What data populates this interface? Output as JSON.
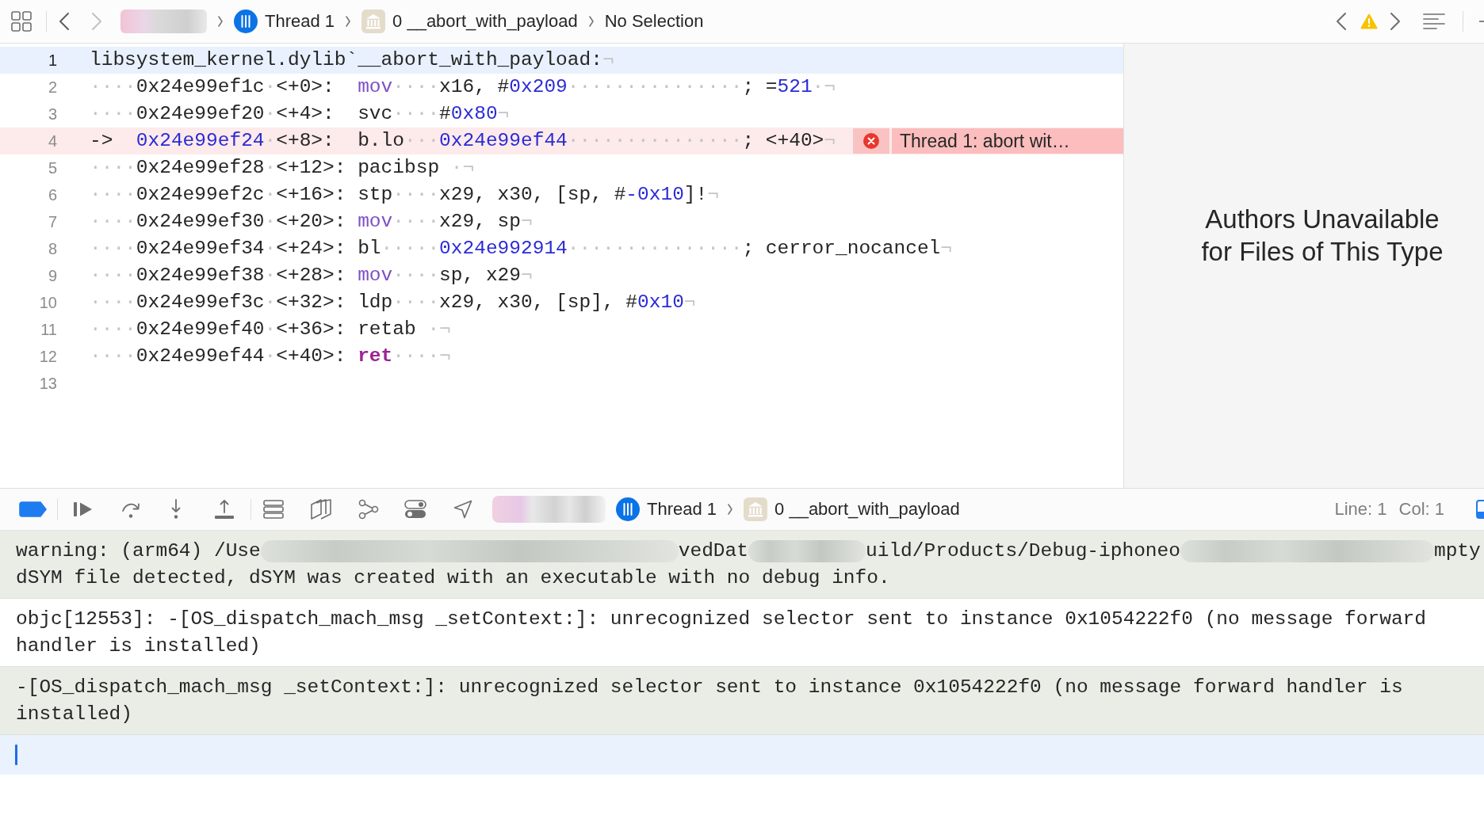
{
  "jump_bar": {
    "back_enabled": true,
    "forward_enabled": false,
    "crumbs": [
      {
        "kind": "redacted"
      },
      {
        "kind": "thread",
        "label": "Thread 1"
      },
      {
        "kind": "frame",
        "label": "0 __abort_with_payload"
      },
      {
        "kind": "plain",
        "label": "No Selection"
      }
    ]
  },
  "editor": {
    "lines": [
      {
        "number": "1",
        "current": true,
        "error": false,
        "tokens": [
          {
            "kind": "plain",
            "text": "libsystem_kernel.dylib`__abort_with_payload:"
          },
          {
            "kind": "ws",
            "text": "¬"
          }
        ]
      },
      {
        "number": "2",
        "current": false,
        "error": false,
        "tokens": [
          {
            "kind": "ws",
            "text": "····"
          },
          {
            "kind": "plain",
            "text": "0x24e99ef1c"
          },
          {
            "kind": "ws",
            "text": "·"
          },
          {
            "kind": "plain",
            "text": "<+0>:  "
          },
          {
            "kind": "mnemonic",
            "text": "mov"
          },
          {
            "kind": "ws",
            "text": "····"
          },
          {
            "kind": "plain",
            "text": "x16, #"
          },
          {
            "kind": "number",
            "text": "0x209"
          },
          {
            "kind": "ws",
            "text": "···············"
          },
          {
            "kind": "plain",
            "text": "; ="
          },
          {
            "kind": "number",
            "text": "521"
          },
          {
            "kind": "ws",
            "text": "·¬"
          }
        ]
      },
      {
        "number": "3",
        "current": false,
        "error": false,
        "tokens": [
          {
            "kind": "ws",
            "text": "····"
          },
          {
            "kind": "plain",
            "text": "0x24e99ef20"
          },
          {
            "kind": "ws",
            "text": "·"
          },
          {
            "kind": "plain",
            "text": "<+4>:  svc"
          },
          {
            "kind": "ws",
            "text": "····"
          },
          {
            "kind": "plain",
            "text": "#"
          },
          {
            "kind": "number",
            "text": "0x80"
          },
          {
            "kind": "ws",
            "text": "¬"
          }
        ]
      },
      {
        "number": "4",
        "current": false,
        "error": true,
        "tokens": [
          {
            "kind": "plain",
            "text": "->  "
          },
          {
            "kind": "number",
            "text": "0x24e99ef24"
          },
          {
            "kind": "ws",
            "text": "·"
          },
          {
            "kind": "plain",
            "text": "<+8>:  b.lo"
          },
          {
            "kind": "ws",
            "text": "···"
          },
          {
            "kind": "number",
            "text": "0x24e99ef44"
          },
          {
            "kind": "ws",
            "text": "···············"
          },
          {
            "kind": "plain",
            "text": "; <+40>"
          },
          {
            "kind": "ws",
            "text": "¬"
          }
        ],
        "annotation": {
          "text": "Thread 1: abort wit…"
        }
      },
      {
        "number": "5",
        "current": false,
        "error": false,
        "tokens": [
          {
            "kind": "ws",
            "text": "····"
          },
          {
            "kind": "plain",
            "text": "0x24e99ef28"
          },
          {
            "kind": "ws",
            "text": "·"
          },
          {
            "kind": "plain",
            "text": "<+12>: pacibsp "
          },
          {
            "kind": "ws",
            "text": "·¬"
          }
        ]
      },
      {
        "number": "6",
        "current": false,
        "error": false,
        "tokens": [
          {
            "kind": "ws",
            "text": "····"
          },
          {
            "kind": "plain",
            "text": "0x24e99ef2c"
          },
          {
            "kind": "ws",
            "text": "·"
          },
          {
            "kind": "plain",
            "text": "<+16>: stp"
          },
          {
            "kind": "ws",
            "text": "····"
          },
          {
            "kind": "plain",
            "text": "x29, x30, [sp, #"
          },
          {
            "kind": "number",
            "text": "-0x10"
          },
          {
            "kind": "plain",
            "text": "]!"
          },
          {
            "kind": "ws",
            "text": "¬"
          }
        ]
      },
      {
        "number": "7",
        "current": false,
        "error": false,
        "tokens": [
          {
            "kind": "ws",
            "text": "····"
          },
          {
            "kind": "plain",
            "text": "0x24e99ef30"
          },
          {
            "kind": "ws",
            "text": "·"
          },
          {
            "kind": "plain",
            "text": "<+20>: "
          },
          {
            "kind": "mnemonic",
            "text": "mov"
          },
          {
            "kind": "ws",
            "text": "····"
          },
          {
            "kind": "plain",
            "text": "x29, sp"
          },
          {
            "kind": "ws",
            "text": "¬"
          }
        ]
      },
      {
        "number": "8",
        "current": false,
        "error": false,
        "tokens": [
          {
            "kind": "ws",
            "text": "····"
          },
          {
            "kind": "plain",
            "text": "0x24e99ef34"
          },
          {
            "kind": "ws",
            "text": "·"
          },
          {
            "kind": "plain",
            "text": "<+24>: bl"
          },
          {
            "kind": "ws",
            "text": "·····"
          },
          {
            "kind": "number",
            "text": "0x24e992914"
          },
          {
            "kind": "ws",
            "text": "···············"
          },
          {
            "kind": "plain",
            "text": "; cerror_nocancel"
          },
          {
            "kind": "ws",
            "text": "¬"
          }
        ]
      },
      {
        "number": "9",
        "current": false,
        "error": false,
        "tokens": [
          {
            "kind": "ws",
            "text": "····"
          },
          {
            "kind": "plain",
            "text": "0x24e99ef38"
          },
          {
            "kind": "ws",
            "text": "·"
          },
          {
            "kind": "plain",
            "text": "<+28>: "
          },
          {
            "kind": "mnemonic",
            "text": "mov"
          },
          {
            "kind": "ws",
            "text": "····"
          },
          {
            "kind": "plain",
            "text": "sp, x29"
          },
          {
            "kind": "ws",
            "text": "¬"
          }
        ]
      },
      {
        "number": "10",
        "current": false,
        "error": false,
        "tokens": [
          {
            "kind": "ws",
            "text": "····"
          },
          {
            "kind": "plain",
            "text": "0x24e99ef3c"
          },
          {
            "kind": "ws",
            "text": "·"
          },
          {
            "kind": "plain",
            "text": "<+32>: ldp"
          },
          {
            "kind": "ws",
            "text": "····"
          },
          {
            "kind": "plain",
            "text": "x29, x30, [sp], #"
          },
          {
            "kind": "number",
            "text": "0x10"
          },
          {
            "kind": "ws",
            "text": "¬"
          }
        ]
      },
      {
        "number": "11",
        "current": false,
        "error": false,
        "tokens": [
          {
            "kind": "ws",
            "text": "····"
          },
          {
            "kind": "plain",
            "text": "0x24e99ef40"
          },
          {
            "kind": "ws",
            "text": "·"
          },
          {
            "kind": "plain",
            "text": "<+36>: retab "
          },
          {
            "kind": "ws",
            "text": "·¬"
          }
        ]
      },
      {
        "number": "12",
        "current": false,
        "error": false,
        "tokens": [
          {
            "kind": "ws",
            "text": "····"
          },
          {
            "kind": "plain",
            "text": "0x24e99ef44"
          },
          {
            "kind": "ws",
            "text": "·"
          },
          {
            "kind": "plain",
            "text": "<+40>: "
          },
          {
            "kind": "keyword",
            "text": "ret"
          },
          {
            "kind": "ws",
            "text": "····¬"
          }
        ]
      },
      {
        "number": "13",
        "current": false,
        "error": false
      }
    ]
  },
  "inspector": {
    "message": "Authors Unavailable for Files of This Type"
  },
  "debug_bar": {
    "breakpoints_enabled": true,
    "crumbs": [
      {
        "kind": "redacted"
      },
      {
        "kind": "thread",
        "label": "Thread 1"
      },
      {
        "kind": "frame",
        "label": "0 __abort_with_payload"
      }
    ],
    "line": "Line: 1",
    "column": "Col: 1"
  },
  "console": {
    "messages": [
      {
        "shaded": true,
        "lines": [
          [
            {
              "kind": "text",
              "text": "warning: (arm64) /Use"
            },
            {
              "kind": "redacted"
            },
            {
              "kind": "text",
              "text": "vedDat"
            },
            {
              "kind": "redacted"
            },
            {
              "kind": "text",
              "text": "uild/Products/Debug-iphoneo"
            },
            {
              "kind": "redacted"
            },
            {
              "kind": "text",
              "text": "mpty"
            }
          ],
          [
            {
              "kind": "text",
              "text": "dSYM file detected, dSYM was created with an executable with no debug info."
            }
          ]
        ]
      },
      {
        "shaded": false,
        "text": "objc[12553]: -[OS_dispatch_mach_msg _setContext:]: unrecognized selector sent to instance 0x1054222f0 (no message forward handler is installed)"
      },
      {
        "shaded": true,
        "text": "-[OS_dispatch_mach_msg _setContext:]: unrecognized selector sent to instance 0x1054222f0 (no message forward handler is installed)"
      }
    ],
    "input": {
      "focused": true
    }
  }
}
